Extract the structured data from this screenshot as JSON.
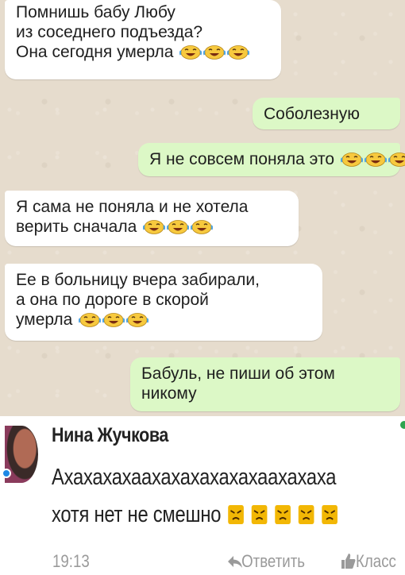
{
  "chat": {
    "messages": [
      {
        "dir": "in",
        "lines": [
          "Помнишь бабу Любу",
          "из соседнего подъезда?",
          "Она сегодня умерла"
        ],
        "emoji_count": 3
      },
      {
        "dir": "out",
        "lines": [
          "Соболезную"
        ],
        "emoji_count": 0
      },
      {
        "dir": "out",
        "lines": [
          "Я не совсем поняла это"
        ],
        "emoji_count": 3
      },
      {
        "dir": "in",
        "lines": [
          "Я сама не поняла и не хотела",
          "верить сначала"
        ],
        "emoji_count": 3
      },
      {
        "dir": "in",
        "lines": [
          "Ее в больницу вчера забирали,",
          "а она по дороге в скорой",
          "умерла"
        ],
        "emoji_count": 3
      },
      {
        "dir": "out",
        "lines": [
          "Бабуль, не пиши об этом",
          "никому"
        ],
        "emoji_count": 0
      }
    ],
    "emoji_icon": "face-with-tears-of-joy-icon",
    "colors": {
      "incoming_bubble": "#ffffff",
      "outgoing_bubble": "#dcf8c6",
      "background": "#e6dccd"
    }
  },
  "comment": {
    "author": "Нина Жучкова",
    "text_line1": "Ахахахахаахахахахахахаахахаха",
    "text_line2": "хотя нет не смешно",
    "angry_emoji_count": 5,
    "angry_icon": "angry-face-icon",
    "time": "19:13",
    "reply_label": "Ответить",
    "class_label": "Класс"
  }
}
